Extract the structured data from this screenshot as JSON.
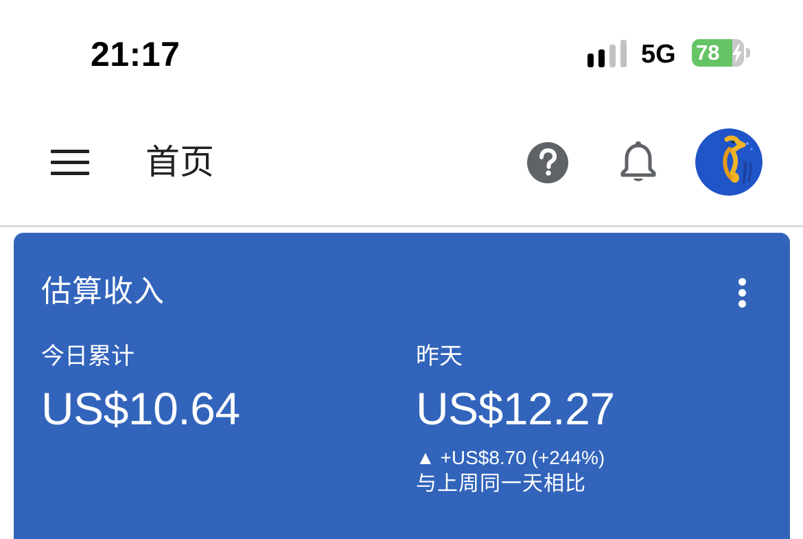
{
  "status_bar": {
    "time": "21:17",
    "network": "5G",
    "battery_percent": "78",
    "battery_level": 0.78,
    "battery_color": "#65c466"
  },
  "app_bar": {
    "title": "首页",
    "icons": [
      "menu-icon",
      "help-icon",
      "bell-icon",
      "avatar-seahorse"
    ]
  },
  "earnings_card": {
    "title": "估算收入",
    "background_color": "#3264bb",
    "today": {
      "label": "今日累计",
      "value": "US$10.64"
    },
    "yesterday": {
      "label": "昨天",
      "value": "US$12.27",
      "change_arrow": "▲",
      "change_text": "+US$8.70 (+244%)",
      "comparison_text": "与上周同一天相比"
    }
  }
}
